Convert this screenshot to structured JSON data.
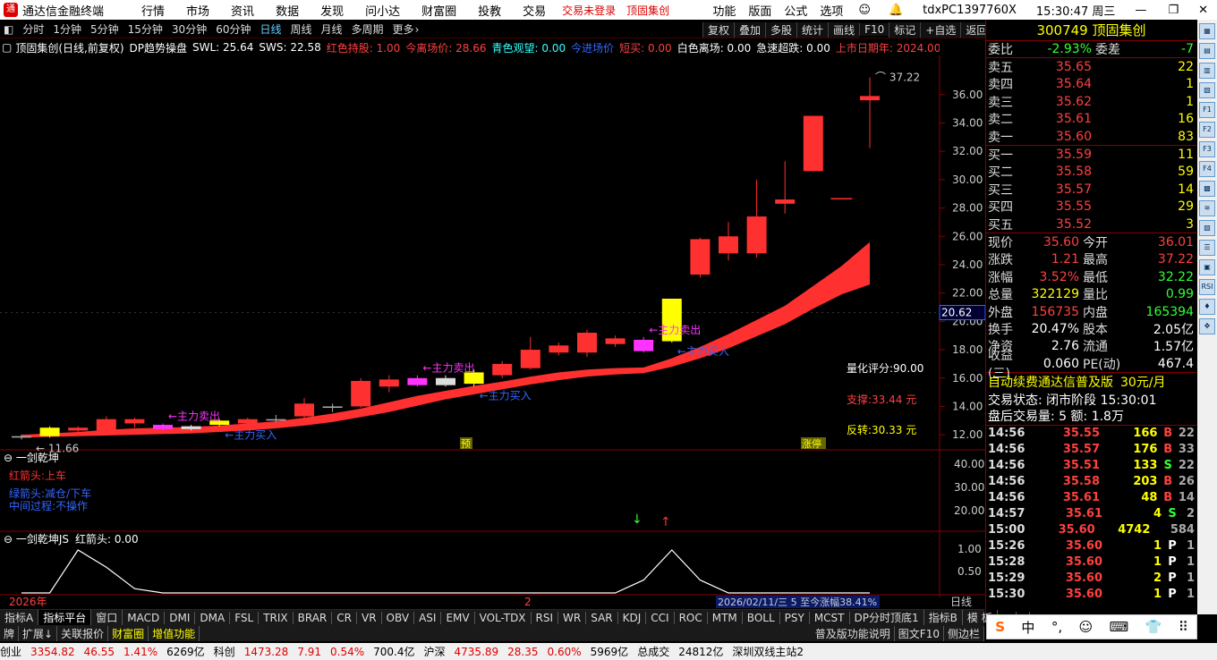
{
  "app": {
    "title": "通达信金融终端",
    "menus": [
      "行情",
      "市场",
      "资讯",
      "数据",
      "发现",
      "问小达",
      "财富圈",
      "投教",
      "交易"
    ],
    "trade_status": "交易未登录",
    "stock_name_red": "顶固集创",
    "right_menus": [
      "功能",
      "版面",
      "公式",
      "选项"
    ],
    "account": "tdxPC1397760X",
    "time": "15:30:47 周三"
  },
  "periods": [
    "分时",
    "1分钟",
    "5分钟",
    "15分钟",
    "30分钟",
    "60分钟",
    "日线",
    "周线",
    "月线",
    "多周期",
    "更多"
  ],
  "selected_period": "日线",
  "chart_buttons": [
    "复权",
    "叠加",
    "多股",
    "统计",
    "画线",
    "F10",
    "标记",
    "+自选",
    "返回"
  ],
  "indicator_line": [
    {
      "t": "顶固集创(日线,前复权)",
      "c": "#ffffff"
    },
    {
      "t": "DP趋势操盘",
      "c": "#ffffff"
    },
    {
      "t": "SWL: 25.64",
      "c": "#ffffff"
    },
    {
      "t": "SWS: 22.58",
      "c": "#ffffff"
    },
    {
      "t": "红色持股: 1.00",
      "c": "#ff4040"
    },
    {
      "t": "今离场价: 28.66",
      "c": "#ff4040"
    },
    {
      "t": "青色观望: 0.00",
      "c": "#33ffff"
    },
    {
      "t": "今进场价",
      "c": "#3366ff"
    },
    {
      "t": "短买: 0.00",
      "c": "#ff4040"
    },
    {
      "t": "白色离场: 0.00",
      "c": "#ffffff"
    },
    {
      "t": "急速超跌: 0.00",
      "c": "#ffffff"
    },
    {
      "t": "上市日期年: 2024.00",
      "c": "#ff4040"
    }
  ],
  "price_axis": [
    "36.00",
    "34.00",
    "32.00",
    "30.00",
    "28.00",
    "26.00",
    "24.00",
    "22.00",
    "20.00",
    "18.00",
    "16.00",
    "14.00",
    "12.00"
  ],
  "price_marker": "20.62",
  "annotations": {
    "high": "37.22",
    "low": "11.66",
    "score": "量化评分:90.00",
    "support": "支撑:33.44 元",
    "reversal": "反转:30.33 元",
    "tag_yu": "预",
    "tag_zhangting": "涨停"
  },
  "signals": {
    "sell": "←主力卖出",
    "buy": "←主力买入"
  },
  "sub1": {
    "title": "一剑乾坤",
    "line1": "红箭头:上车",
    "line2": "绿箭头:减仓/下车",
    "line3": "中间过程:不操作",
    "axis": [
      "40.00",
      "30.00",
      "20.00"
    ]
  },
  "sub2": {
    "title": "一剑乾坤JS",
    "value": "红箭头: 0.00",
    "axis": [
      "1.00",
      "0.50"
    ]
  },
  "xaxis": {
    "year": "2026年",
    "mark": "2",
    "info": "2026/02/11/三 5 至今涨幅38.41%",
    "period_tag": "日线"
  },
  "chart_data": {
    "type": "candlestick",
    "ylim": [
      11,
      37.5
    ],
    "candles": [
      {
        "o": 11.8,
        "c": 11.9,
        "h": 12.0,
        "l": 11.66,
        "k": "gray"
      },
      {
        "o": 11.9,
        "c": 12.5,
        "h": 12.6,
        "l": 11.8,
        "k": "yellow"
      },
      {
        "o": 12.3,
        "c": 12.5,
        "h": 12.6,
        "l": 12.2,
        "k": "red"
      },
      {
        "o": 12.3,
        "c": 13.1,
        "h": 13.3,
        "l": 12.2,
        "k": "red"
      },
      {
        "o": 12.8,
        "c": 13.1,
        "h": 13.2,
        "l": 12.5,
        "k": "red"
      },
      {
        "o": 12.4,
        "c": 12.7,
        "h": 12.8,
        "l": 12.3,
        "k": "magenta"
      },
      {
        "o": 12.4,
        "c": 12.6,
        "h": 12.7,
        "l": 12.3,
        "k": "white"
      },
      {
        "o": 12.7,
        "c": 13.0,
        "h": 13.1,
        "l": 12.6,
        "k": "yellow"
      },
      {
        "o": 12.8,
        "c": 13.1,
        "h": 13.2,
        "l": 12.6,
        "k": "red"
      },
      {
        "o": 13.0,
        "c": 13.1,
        "h": 13.4,
        "l": 12.9,
        "k": "gray"
      },
      {
        "o": 13.3,
        "c": 14.2,
        "h": 14.6,
        "l": 13.2,
        "k": "red"
      },
      {
        "o": 13.9,
        "c": 14.0,
        "h": 14.2,
        "l": 13.6,
        "k": "gray"
      },
      {
        "o": 14.0,
        "c": 15.8,
        "h": 16.0,
        "l": 13.9,
        "k": "red"
      },
      {
        "o": 15.4,
        "c": 15.9,
        "h": 16.2,
        "l": 15.0,
        "k": "red"
      },
      {
        "o": 15.5,
        "c": 16.0,
        "h": 16.2,
        "l": 15.4,
        "k": "magenta"
      },
      {
        "o": 15.5,
        "c": 16.0,
        "h": 16.2,
        "l": 15.4,
        "k": "white"
      },
      {
        "o": 15.6,
        "c": 16.4,
        "h": 16.6,
        "l": 15.4,
        "k": "yellow"
      },
      {
        "o": 16.2,
        "c": 17.0,
        "h": 17.2,
        "l": 16.0,
        "k": "red"
      },
      {
        "o": 16.7,
        "c": 18.0,
        "h": 18.9,
        "l": 16.6,
        "k": "red"
      },
      {
        "o": 17.8,
        "c": 18.3,
        "h": 18.5,
        "l": 17.6,
        "k": "red"
      },
      {
        "o": 17.8,
        "c": 19.2,
        "h": 19.4,
        "l": 17.5,
        "k": "red"
      },
      {
        "o": 18.4,
        "c": 18.8,
        "h": 19.0,
        "l": 18.2,
        "k": "red"
      },
      {
        "o": 17.9,
        "c": 18.7,
        "h": 18.9,
        "l": 17.8,
        "k": "magenta"
      },
      {
        "o": 18.6,
        "c": 21.6,
        "h": 21.6,
        "l": 18.5,
        "k": "yellow"
      },
      {
        "o": 23.3,
        "c": 25.8,
        "h": 25.9,
        "l": 23.1,
        "k": "red"
      },
      {
        "o": 24.8,
        "c": 26.0,
        "h": 27.0,
        "l": 24.3,
        "k": "red"
      },
      {
        "o": 24.8,
        "c": 27.4,
        "h": 30.0,
        "l": 24.5,
        "k": "red"
      },
      {
        "o": 28.3,
        "c": 28.6,
        "h": 31.3,
        "l": 27.6,
        "k": "red"
      },
      {
        "o": 30.6,
        "c": 34.5,
        "h": 34.5,
        "l": 30.6,
        "k": "red"
      },
      {
        "o": 28.7,
        "c": 28.7,
        "h": 28.7,
        "l": 28.7,
        "k": "redline"
      },
      {
        "o": 35.6,
        "c": 35.9,
        "h": 37.22,
        "l": 32.22,
        "k": "red"
      }
    ],
    "band_upper": [
      12.0,
      12.1,
      12.2,
      12.35,
      12.45,
      12.5,
      12.55,
      12.65,
      12.8,
      12.95,
      13.2,
      13.5,
      13.85,
      14.3,
      14.75,
      15.1,
      15.45,
      15.75,
      16.1,
      16.4,
      16.6,
      16.7,
      16.75,
      17.4,
      18.2,
      19.1,
      20.1,
      21.1,
      22.5,
      23.9,
      25.6
    ],
    "band_lower": [
      11.8,
      11.85,
      11.9,
      11.95,
      12.0,
      12.05,
      12.1,
      12.2,
      12.3,
      12.45,
      12.65,
      12.9,
      13.25,
      13.6,
      14.05,
      14.5,
      14.85,
      15.2,
      15.55,
      15.85,
      16.1,
      16.25,
      16.35,
      16.8,
      17.4,
      18.1,
      18.95,
      19.8,
      20.9,
      21.9,
      22.6
    ],
    "sub2_curve": [
      0,
      0,
      1,
      0.6,
      0.1,
      0,
      0,
      0,
      0,
      0,
      0,
      0,
      0,
      0,
      0,
      0,
      0,
      0,
      0,
      0,
      0,
      0,
      0.3,
      1,
      0.3,
      0,
      0,
      0,
      0,
      0,
      0
    ]
  },
  "quote": {
    "code": "300749",
    "name": "顶固集创",
    "wb_label": "委比",
    "wb": "-2.93%",
    "wc_label": "委差",
    "wc": "-7",
    "asks": [
      {
        "l": "卖五",
        "p": "35.65",
        "v": "22"
      },
      {
        "l": "卖四",
        "p": "35.64",
        "v": "1"
      },
      {
        "l": "卖三",
        "p": "35.62",
        "v": "1"
      },
      {
        "l": "卖二",
        "p": "35.61",
        "v": "16"
      },
      {
        "l": "卖一",
        "p": "35.60",
        "v": "83"
      }
    ],
    "bids": [
      {
        "l": "买一",
        "p": "35.59",
        "v": "11"
      },
      {
        "l": "买二",
        "p": "35.58",
        "v": "59"
      },
      {
        "l": "买三",
        "p": "35.57",
        "v": "14"
      },
      {
        "l": "买四",
        "p": "35.55",
        "v": "29"
      },
      {
        "l": "买五",
        "p": "35.52",
        "v": "3"
      }
    ],
    "stats": [
      {
        "a": "现价",
        "b": "35.60",
        "bc": "red",
        "c": "今开",
        "d": "36.01",
        "dc": "red"
      },
      {
        "a": "涨跌",
        "b": "1.21",
        "bc": "red",
        "c": "最高",
        "d": "37.22",
        "dc": "red"
      },
      {
        "a": "涨幅",
        "b": "3.52%",
        "bc": "red",
        "c": "最低",
        "d": "32.22",
        "dc": "grn"
      },
      {
        "a": "总量",
        "b": "322129",
        "bc": "yel",
        "c": "量比",
        "d": "0.99",
        "dc": "grn"
      },
      {
        "a": "外盘",
        "b": "156735",
        "bc": "red",
        "c": "内盘",
        "d": "165394",
        "dc": "grn"
      },
      {
        "a": "换手",
        "b": "20.47%",
        "bc": "wht",
        "c": "股本",
        "d": "2.05亿",
        "dc": "wht"
      },
      {
        "a": "净资",
        "b": "2.76",
        "bc": "wht",
        "c": "流通",
        "d": "1.57亿",
        "dc": "wht"
      },
      {
        "a": "收益(三)",
        "b": "0.060",
        "bc": "wht",
        "c": "PE(动)",
        "d": "467.4",
        "dc": "wht"
      }
    ],
    "promo": "自动续费通达信普及版",
    "promo_price": "30元/月",
    "trade_state": "交易状态: 闭市阶段 15:30:01",
    "after_hours": "盘后交易量: 5  额: 1.8万",
    "ticks": [
      {
        "t": "14:56",
        "p": "35.55",
        "v": "166",
        "f": "B",
        "x": "22",
        "fc": "red",
        "vc": "yel"
      },
      {
        "t": "14:56",
        "p": "35.57",
        "v": "176",
        "f": "B",
        "x": "33",
        "fc": "red",
        "vc": "yel"
      },
      {
        "t": "14:56",
        "p": "35.51",
        "v": "133",
        "f": "S",
        "x": "22",
        "fc": "grn",
        "vc": "yel"
      },
      {
        "t": "14:56",
        "p": "35.58",
        "v": "203",
        "f": "B",
        "x": "26",
        "fc": "red",
        "vc": "yel"
      },
      {
        "t": "14:56",
        "p": "35.61",
        "v": "48",
        "f": "B",
        "x": "14",
        "fc": "red",
        "vc": "yel"
      },
      {
        "t": "14:57",
        "p": "35.61",
        "v": "4",
        "f": "S",
        "x": "2",
        "fc": "grn",
        "vc": "yel"
      },
      {
        "t": "15:00",
        "p": "35.60",
        "v": "4742",
        "f": "",
        "x": "584",
        "fc": "wht",
        "vc": "mag"
      },
      {
        "t": "15:26",
        "p": "35.60",
        "v": "1",
        "f": "P",
        "x": "1",
        "fc": "wht",
        "vc": "yel"
      },
      {
        "t": "15:28",
        "p": "35.60",
        "v": "1",
        "f": "P",
        "x": "1",
        "fc": "wht",
        "vc": "yel"
      },
      {
        "t": "15:29",
        "p": "35.60",
        "v": "2",
        "f": "P",
        "x": "1",
        "fc": "wht",
        "vc": "yel"
      },
      {
        "t": "15:30",
        "p": "35.60",
        "v": "1",
        "f": "P",
        "x": "1",
        "fc": "wht",
        "vc": "yel"
      }
    ]
  },
  "tabs": [
    "指标A",
    "指标平台",
    "窗口",
    "MACD",
    "DMI",
    "DMA",
    "FSL",
    "TRIX",
    "BRAR",
    "CR",
    "VR",
    "OBV",
    "ASI",
    "EMV",
    "VOL-TDX",
    "RSI",
    "WR",
    "SAR",
    "KDJ",
    "CCI",
    "ROC",
    "MTM",
    "BOLL",
    "PSY",
    "MCST",
    "DP分时顶底1",
    "指标B",
    "模 板",
    "+",
    "-"
  ],
  "tabs2": [
    "牌",
    "扩展↓",
    "关联报价",
    "财富圈",
    "增值功能"
  ],
  "tabs2_right": [
    "普及版功能说明",
    "图文F10",
    "侧边栏"
  ],
  "status": [
    {
      "t": "创业",
      "c": "k"
    },
    {
      "t": "3354.82",
      "c": "r"
    },
    {
      "t": "46.55",
      "c": "r"
    },
    {
      "t": "1.41%",
      "c": "r"
    },
    {
      "t": "6269亿",
      "c": "k"
    },
    {
      "t": "科创",
      "c": "k"
    },
    {
      "t": "1473.28",
      "c": "r"
    },
    {
      "t": "7.91",
      "c": "r"
    },
    {
      "t": "0.54%",
      "c": "r"
    },
    {
      "t": "700.4亿",
      "c": "k"
    },
    {
      "t": "沪深",
      "c": "k"
    },
    {
      "t": "4735.89",
      "c": "r"
    },
    {
      "t": "28.35",
      "c": "r"
    },
    {
      "t": "0.60%",
      "c": "r"
    },
    {
      "t": "5969亿",
      "c": "k"
    },
    {
      "t": "总成交",
      "c": "k"
    },
    {
      "t": "24812亿",
      "c": "k"
    },
    {
      "t": "深圳双线主站2",
      "c": "k"
    }
  ],
  "ime": [
    "S",
    "中",
    "°,",
    "☺",
    "⌨",
    "👕",
    "⠿"
  ]
}
